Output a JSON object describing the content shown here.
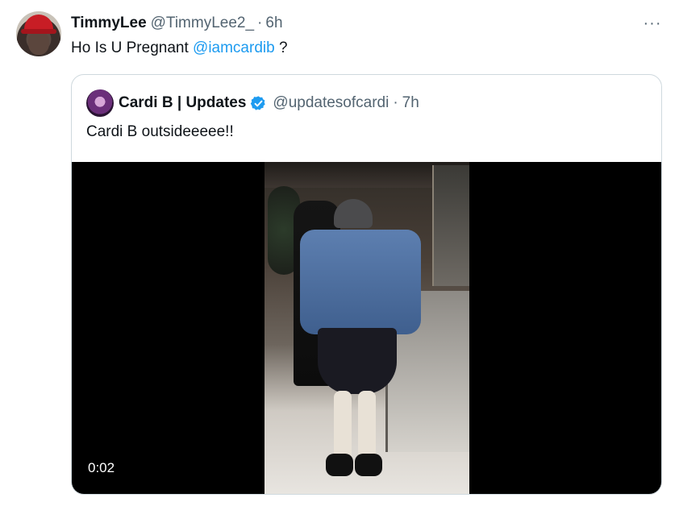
{
  "tweet": {
    "author_name": "TimmyLee",
    "author_handle": "@TimmyLee2_",
    "separator": "·",
    "time": "6h",
    "more_label": "···",
    "text_before": "Ho Is U Pregnant ",
    "mention": "@iamcardib",
    "text_after": " ?"
  },
  "quote": {
    "author_name": "Cardi B | Updates",
    "author_handle": "@updatesofcardi",
    "separator": "·",
    "time": "7h",
    "text": "Cardi B outsideeeee!!",
    "video": {
      "duration": "0:02"
    }
  },
  "colors": {
    "accent": "#1d9bf0",
    "secondary_text": "#536471",
    "border": "#cfd9de",
    "verified_badge": "#1d9bf0"
  },
  "icons": {
    "verified": "verified-badge-icon",
    "more": "more-options-icon"
  }
}
